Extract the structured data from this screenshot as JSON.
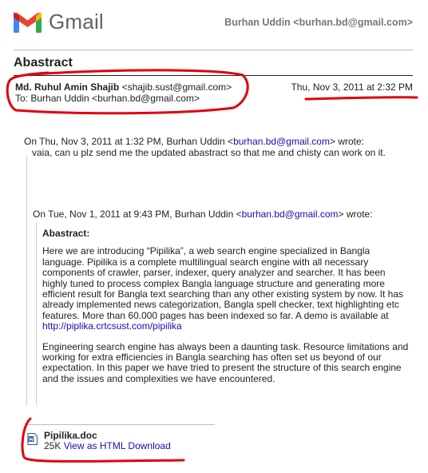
{
  "app": {
    "name": "Gmail",
    "account": "Burhan Uddin <burhan.bd@gmail.com>"
  },
  "message": {
    "subject": "Abastract",
    "from_name": "Md. Ruhul Amin Shajib",
    "from_email": "<shajib.sust@gmail.com>",
    "to": "To: Burhan Uddin <burhan.bd@gmail.com>",
    "date": "Thu, Nov 3, 2011 at 2:32 PM"
  },
  "quote1": {
    "prefix": "On Thu, Nov 3, 2011 at 1:32 PM, Burhan Uddin <",
    "email": "burhan.bd@gmail.com",
    "suffix": "> wrote:",
    "body": "vaia, can u plz send me the updated abastract so that me and chisty can work on it."
  },
  "quote2": {
    "prefix": "On Tue, Nov 1, 2011 at 9:43 PM, Burhan Uddin <",
    "email": "burhan.bd@gmail.com",
    "suffix": "> wrote:",
    "heading": "Abastract:",
    "p1": "Here we are introducing “Pipilika”, a web search engine specialized in Bangla language. Pipilika is a complete multilingual search engine with all necessary components of crawler, parser, indexer, query analyzer and searcher. It has been highly tuned to process complex Bangla language structure and generating more efficient result for Bangla text searching than any other existing system by now. It has already implemented news categorization, Bangla spell checker, text highlighting etc features. More than 60.000 pages has been indexed so far. A demo is available at",
    "link": "http://piplika.crtcsust.com/pipilika",
    "p2": "Engineering search engine has always been a daunting task. Resource limitations and working for extra efficiencies in Bangla searching has often set us beyond of our expectation. In this paper we have tried to present the structure of this search engine and the issues and complexities we have encountered."
  },
  "attachment": {
    "filename": "Pipilika.doc",
    "size": "25K",
    "view_html": "View as HTML",
    "download": "Download"
  },
  "colors": {
    "annotation": "#e0000d",
    "link": "#1a0dab"
  },
  "icons": {
    "logo": "gmail-m-icon",
    "attachment": "word-doc-icon"
  }
}
